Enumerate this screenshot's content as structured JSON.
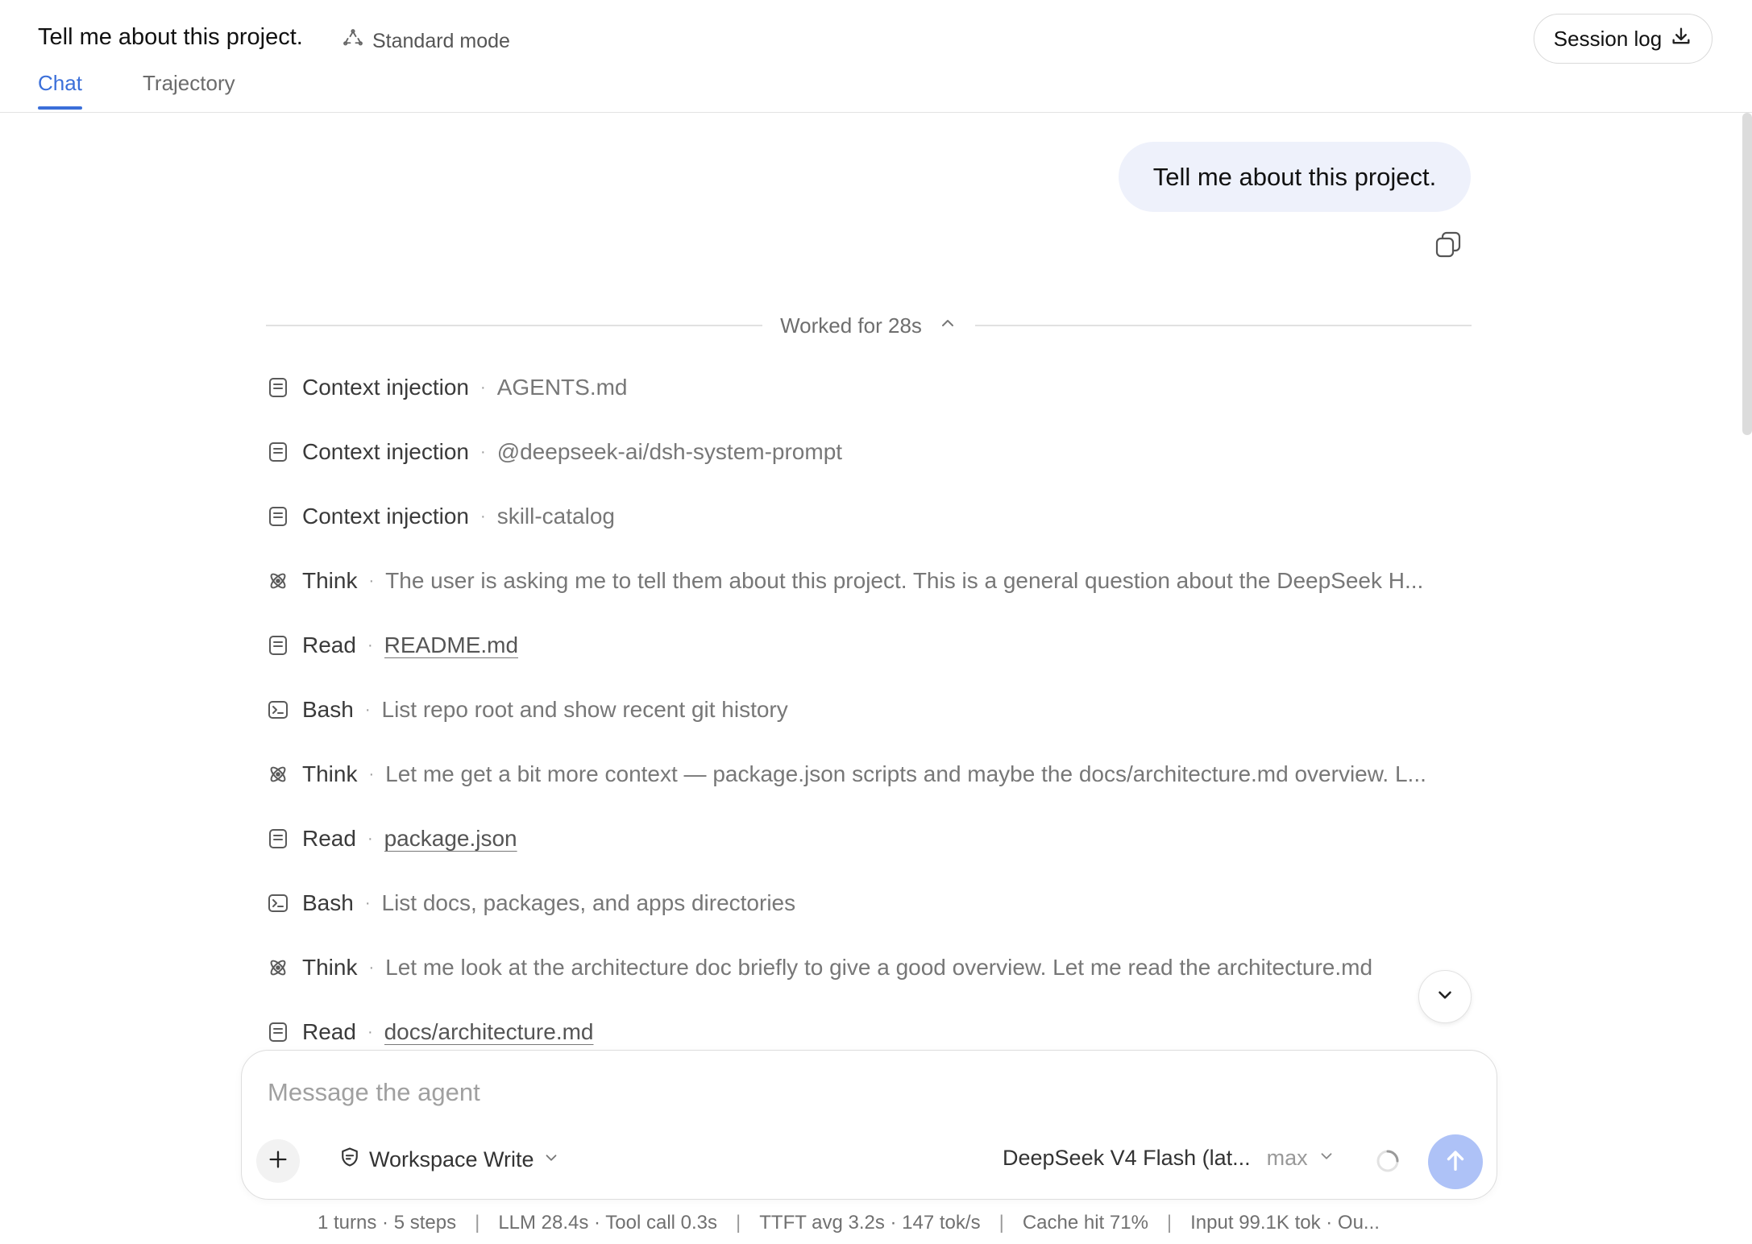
{
  "header": {
    "title": "Tell me about this project.",
    "mode": "Standard mode",
    "session_log": "Session log",
    "tabs": [
      {
        "label": "Chat",
        "active": true
      },
      {
        "label": "Trajectory",
        "active": false
      }
    ]
  },
  "conversation": {
    "user_message": "Tell me about this project.",
    "worked_label": "Worked for 28s",
    "steps": [
      {
        "icon": "file-icon",
        "kind": "Context injection",
        "detail": "AGENTS.md",
        "link": false
      },
      {
        "icon": "file-icon",
        "kind": "Context injection",
        "detail": "@deepseek-ai/dsh-system-prompt",
        "link": false
      },
      {
        "icon": "file-icon",
        "kind": "Context injection",
        "detail": "skill-catalog",
        "link": false
      },
      {
        "icon": "think-icon",
        "kind": "Think",
        "detail": "The user is asking me to tell them about this project. This is a general question about the DeepSeek H...",
        "link": false
      },
      {
        "icon": "file-icon",
        "kind": "Read",
        "detail": "README.md",
        "link": true
      },
      {
        "icon": "terminal-icon",
        "kind": "Bash",
        "detail": "List repo root and show recent git history",
        "link": false
      },
      {
        "icon": "think-icon",
        "kind": "Think",
        "detail": "Let me get a bit more context — package.json scripts and maybe the docs/architecture.md overview. L...",
        "link": false
      },
      {
        "icon": "file-icon",
        "kind": "Read",
        "detail": "package.json",
        "link": true
      },
      {
        "icon": "terminal-icon",
        "kind": "Bash",
        "detail": "List docs, packages, and apps directories",
        "link": false
      },
      {
        "icon": "think-icon",
        "kind": "Think",
        "detail": "Let me look at the architecture doc briefly to give a good overview. Let me read the architecture.md",
        "link": false
      },
      {
        "icon": "file-icon",
        "kind": "Read",
        "detail": "docs/architecture.md",
        "link": true
      }
    ]
  },
  "composer": {
    "placeholder": "Message the agent",
    "permission": "Workspace Write",
    "model": "DeepSeek V4 Flash (lat...",
    "effort": "max"
  },
  "status_bar": {
    "items": [
      "1 turns · 5 steps",
      "LLM 28.4s · Tool call 0.3s",
      "TTFT avg 3.2s · 147 tok/s",
      "Cache hit 71%",
      "Input 99.1K tok · Ou..."
    ]
  },
  "colors": {
    "accent": "#3b6fd9",
    "bubble": "#eef1fb",
    "send_button": "#aec2f7"
  }
}
